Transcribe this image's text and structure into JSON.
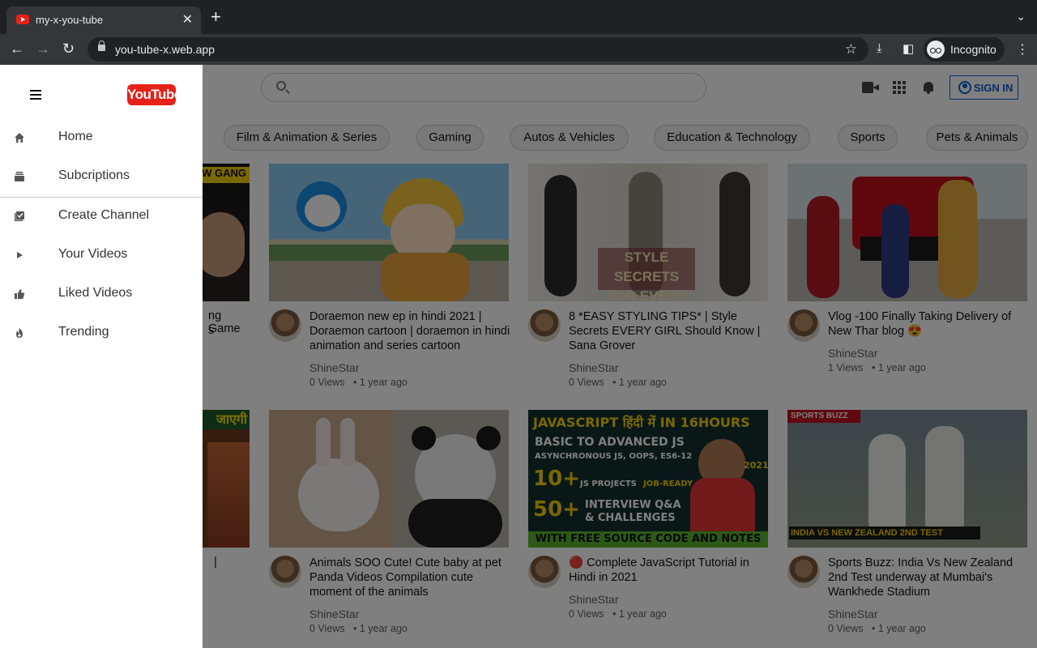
{
  "browser": {
    "tab_title": "my-x-you-tube",
    "url": "you-tube-x.web.app",
    "profile_label": "Incognito"
  },
  "sidebar": {
    "logo_text": "YouTube",
    "items": [
      {
        "label": "Home",
        "icon": "home-icon"
      },
      {
        "label": "Subcriptions",
        "icon": "subscriptions-icon"
      },
      {
        "label": "Create Channel",
        "icon": "create-channel-icon"
      },
      {
        "label": "Your Videos",
        "icon": "play-icon"
      },
      {
        "label": "Liked Videos",
        "icon": "thumbs-up-icon"
      },
      {
        "label": "Trending",
        "icon": "fire-icon"
      }
    ]
  },
  "header": {
    "search_placeholder": "",
    "sign_in_label": "SIGN IN"
  },
  "chips": [
    "Film & Animation & Series",
    "Gaming",
    "Autos & Vehicles",
    "Education & Technology",
    "Sports",
    "Pets & Animals"
  ],
  "videos": [
    {
      "title": "Doraemon new ep in hindi 2021 | Doraemon cartoon | doraemon in hindi animation and series cartoon",
      "channel": "ShineStar",
      "views": "0 Views",
      "age": "• 1 year ago"
    },
    {
      "title": "8 *EASY STYLING TIPS* | Style Secrets EVERY GIRL Should Know | Sana Grover",
      "channel": "ShineStar",
      "views": "0 Views",
      "age": "• 1 year ago",
      "thumb_text": "STYLE SECRETS FOR EVERY GIRL"
    },
    {
      "title": "Vlog -100 Finally Taking Delivery of New Thar blog 😍",
      "channel": "ShineStar",
      "views": "1 Views",
      "age": "• 1 year ago"
    },
    {
      "title": "Animals SOO Cute! Cute baby at pet Panda Videos Compilation cute moment of the animals",
      "channel": "ShineStar",
      "views": "0 Views",
      "age": "• 1 year ago"
    },
    {
      "title": "🔴 Complete JavaScript Tutorial in Hindi in 2021",
      "channel": "ShineStar",
      "views": "0 Views",
      "age": "• 1 year ago"
    },
    {
      "title": "Sports Buzz: India Vs New Zealand 2nd Test underway at Mumbai's Wankhede Stadium",
      "channel": "ShineStar",
      "views": "0 Views",
      "age": "• 1 year ago",
      "thumb_text": "INDIA VS NEW ZEALAND 2ND TEST",
      "thumb_badge": "SPORTS BUZZ"
    }
  ],
  "partial_cards": {
    "top_thumb_text": "W GANG",
    "top_title_line1": "ng Game",
    "top_title_line2": "s",
    "bottom_thumb_text": "जाएगी",
    "bottom_title": "|"
  },
  "js_thumb": {
    "line1": "JAVASCRIPT हिंदी में IN 16HOURS",
    "line2": "BASIC TO ADVANCED JS",
    "line3": "ASYNCHRONOUS JS, OOPS, ES6-12",
    "line4a": "10+",
    "line4b": "JS PROJECTS",
    "line4c": "JOB-READY",
    "line5a": "50+",
    "line5b": "INTERVIEW Q&A",
    "line5c": "& CHALLENGES",
    "line6": "WITH FREE SOURCE CODE AND NOTES",
    "year": "2021"
  },
  "colors": {
    "brand": "#e62117",
    "link": "#065fd4"
  }
}
